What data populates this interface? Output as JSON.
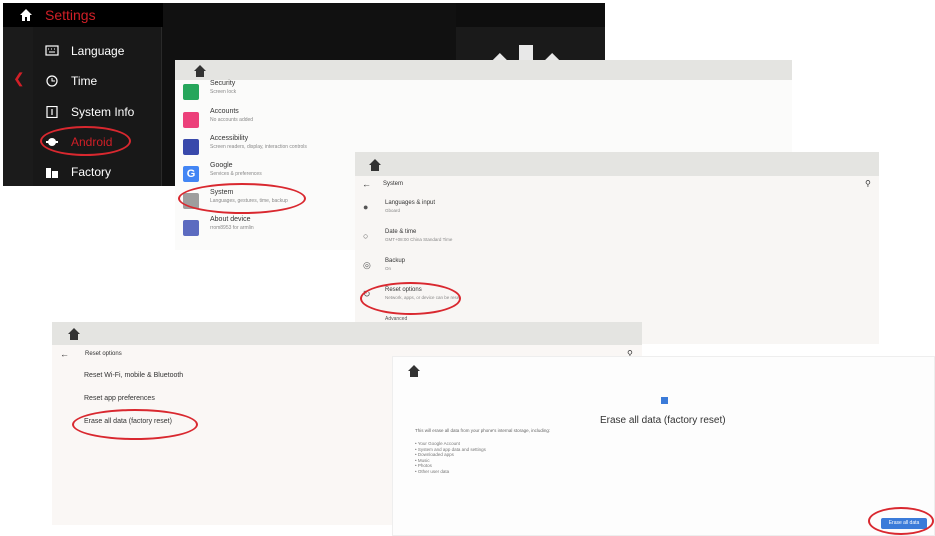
{
  "panel1": {
    "title": "Settings",
    "menu": [
      {
        "icon": "keyboard-icon",
        "label": "Language"
      },
      {
        "icon": "clock-icon",
        "label": "Time"
      },
      {
        "icon": "info-icon",
        "label": "System Info"
      },
      {
        "icon": "android-icon",
        "label": "Android"
      },
      {
        "icon": "factory-icon",
        "label": "Factory"
      }
    ],
    "accent": "#d11f27"
  },
  "panel2": {
    "items": [
      {
        "icon": "lock-icon",
        "color": "#26a65b",
        "title": "Security",
        "subtitle": "Screen lock"
      },
      {
        "icon": "account-icon",
        "color": "#ec407a",
        "title": "Accounts",
        "subtitle": "No accounts added"
      },
      {
        "icon": "accessibility-icon",
        "color": "#3949ab",
        "title": "Accessibility",
        "subtitle": "Screen readers, display, interaction controls"
      },
      {
        "icon": "google-icon",
        "color": "#4285f4",
        "title": "Google",
        "subtitle": "Services & preferences"
      },
      {
        "icon": "system-icon",
        "color": "#9e9e9e",
        "title": "System",
        "subtitle": "Languages, gestures, time, backup"
      },
      {
        "icon": "device-icon",
        "color": "#5c6bc0",
        "title": "About device",
        "subtitle": "rrom8953 for armlin"
      }
    ]
  },
  "panel3": {
    "toolbar_title": "System",
    "items": [
      {
        "icon": "globe-icon",
        "title": "Languages & input",
        "subtitle": "Gboard"
      },
      {
        "icon": "clock-icon",
        "title": "Date & time",
        "subtitle": "GMT+08:00 China Standard Time"
      },
      {
        "icon": "backup-icon",
        "title": "Backup",
        "subtitle": "On"
      },
      {
        "icon": "reset-icon",
        "title": "Reset options",
        "subtitle": "Network, apps, or device can be reset"
      }
    ],
    "advanced": "Advanced"
  },
  "panel4": {
    "toolbar_title": "Reset options",
    "items": [
      "Reset Wi-Fi, mobile & Bluetooth",
      "Reset app preferences",
      "Erase all data (factory reset)"
    ]
  },
  "panel5": {
    "heading": "Erase all data (factory reset)",
    "intro": "This will erase all data from your phone's internal storage, including:",
    "list": [
      "Your Google Account",
      "System and app data and settings",
      "Downloaded apps",
      "Music",
      "Photos",
      "Other user data"
    ],
    "button": "Erase all data",
    "button_color": "#3b7bd9"
  }
}
